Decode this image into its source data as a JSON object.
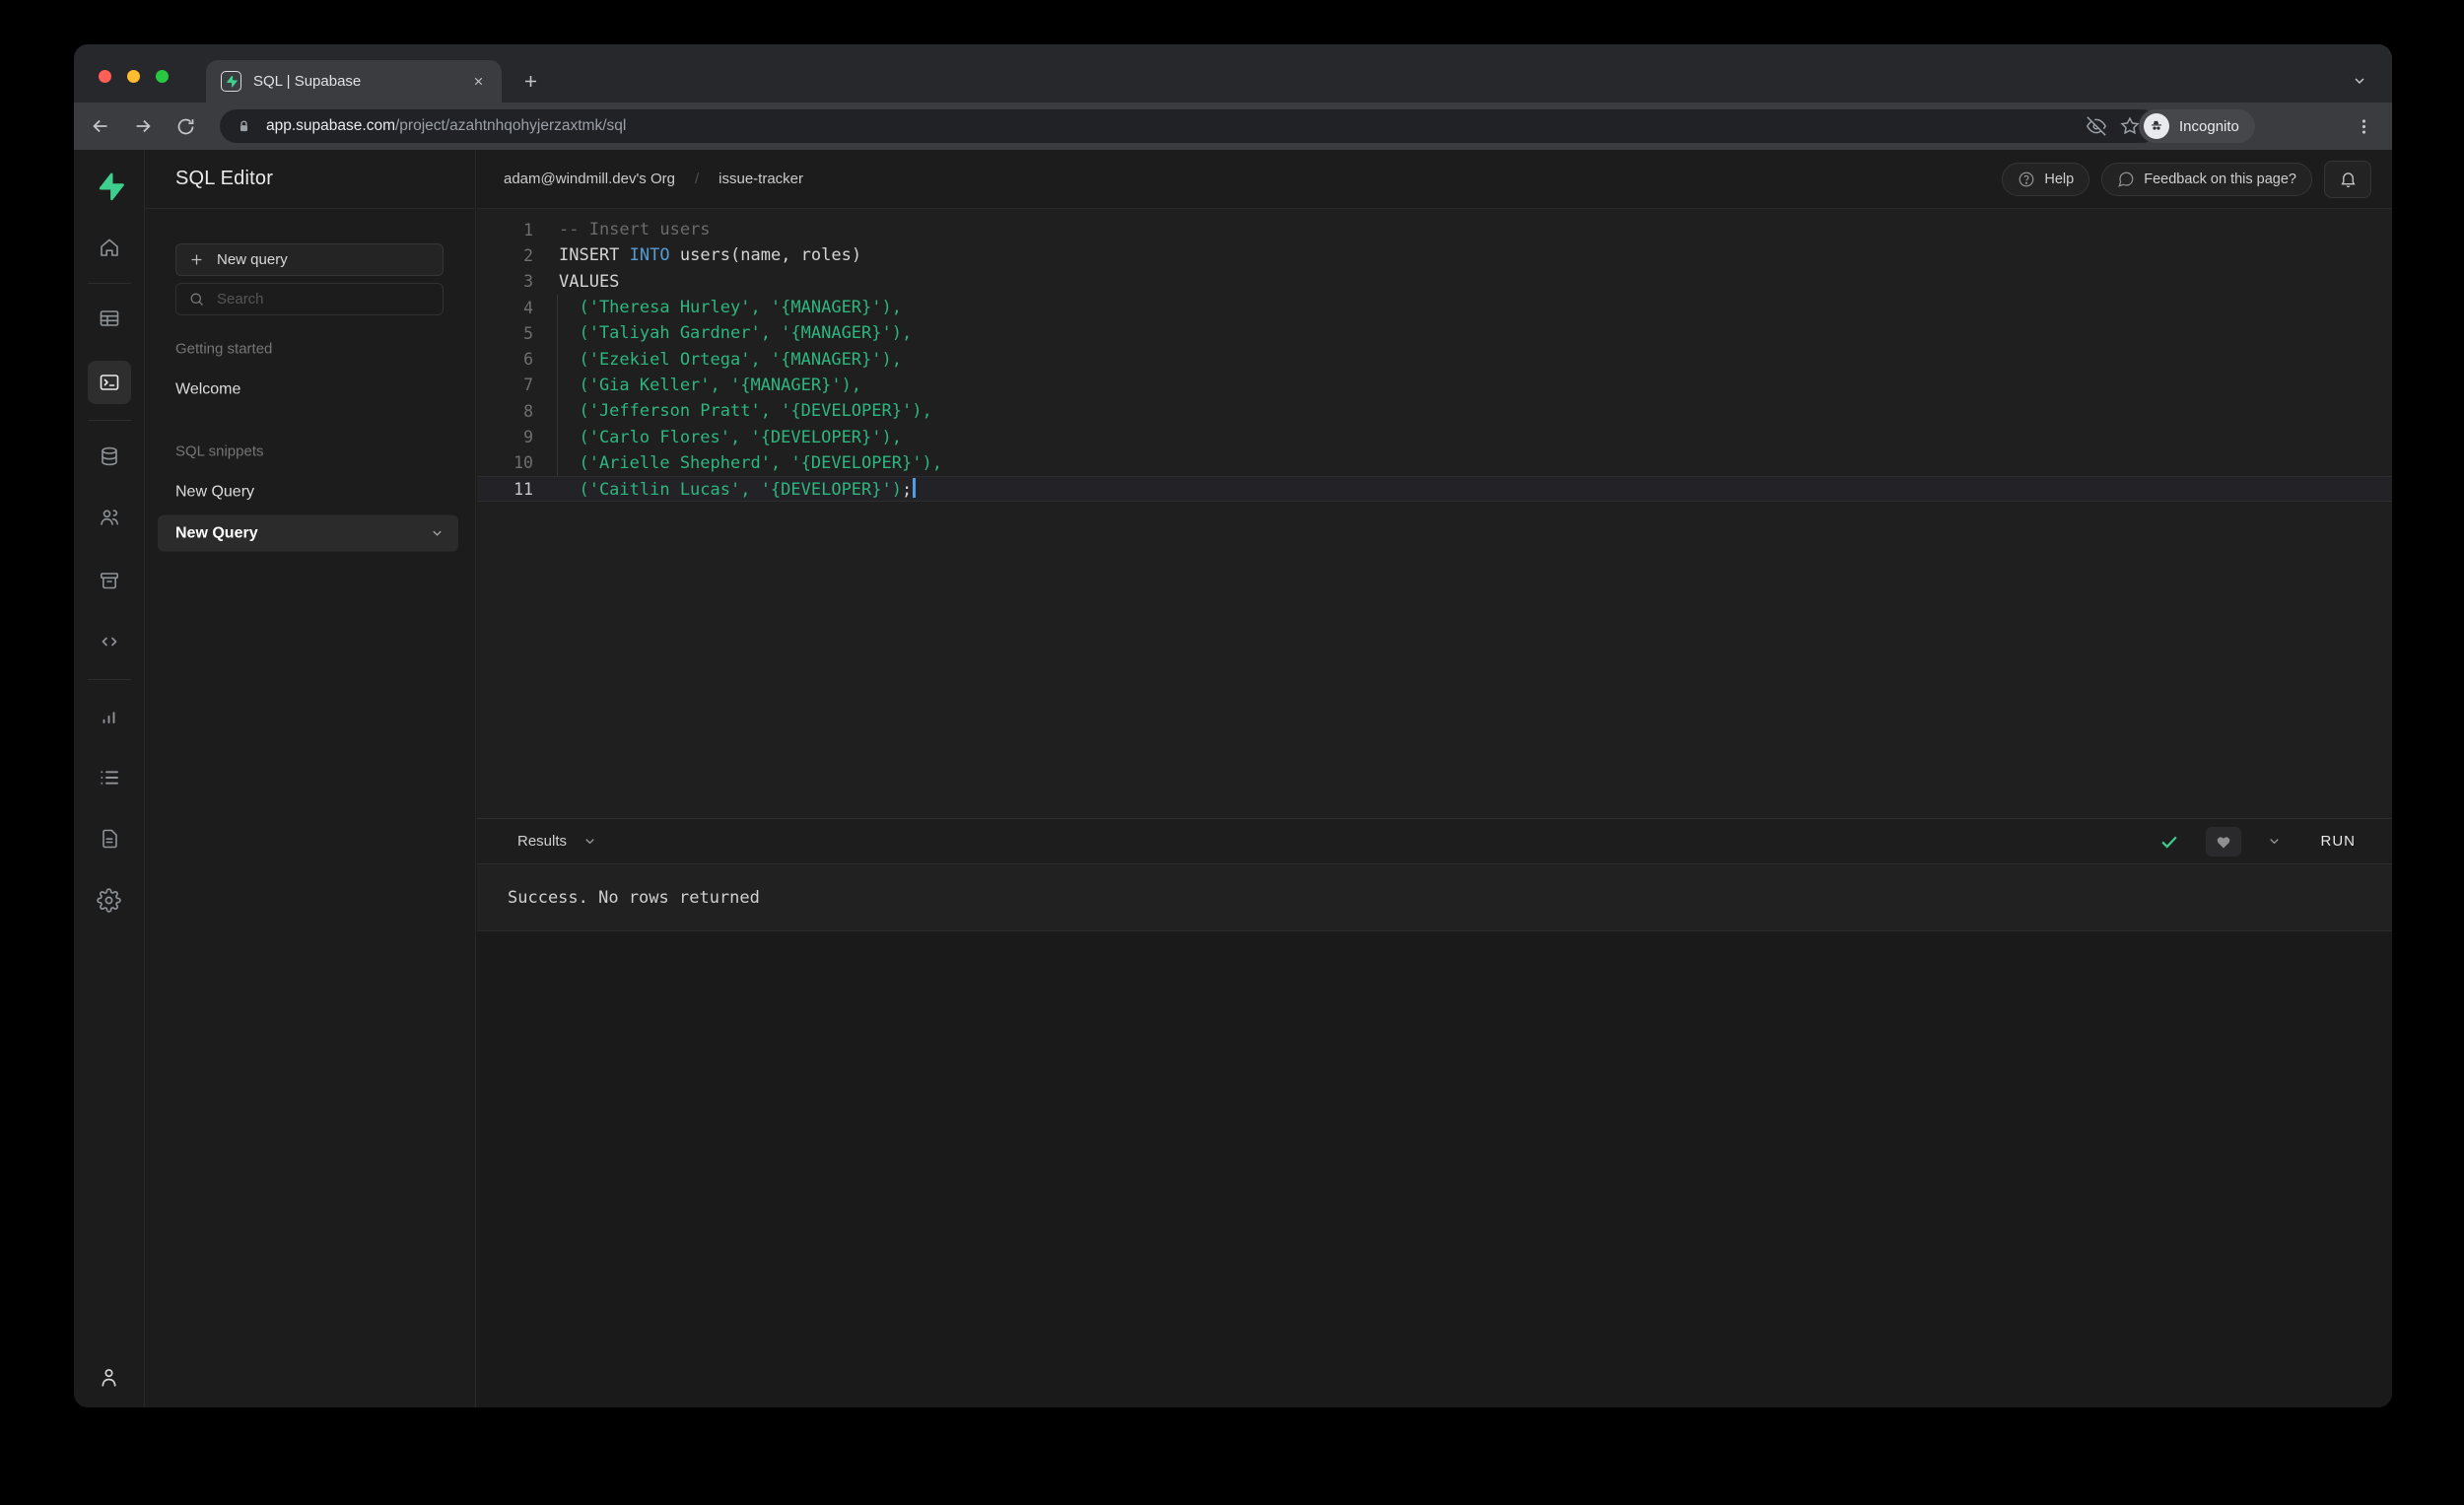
{
  "browser": {
    "tab": {
      "title": "SQL | Supabase"
    },
    "url": {
      "domain": "app.supabase.com",
      "path": "/project/azahtnhqohyjerzaxtmk/sql"
    },
    "incognito_label": "Incognito"
  },
  "rail": {
    "items": [
      {
        "name": "supabase-logo"
      },
      {
        "name": "home"
      },
      {
        "name": "divider"
      },
      {
        "name": "table-editor"
      },
      {
        "name": "sql-editor",
        "active": true
      },
      {
        "name": "divider"
      },
      {
        "name": "database"
      },
      {
        "name": "auth"
      },
      {
        "name": "storage"
      },
      {
        "name": "edge-functions"
      },
      {
        "name": "divider"
      },
      {
        "name": "reports"
      },
      {
        "name": "logs"
      },
      {
        "name": "api-docs"
      },
      {
        "name": "settings"
      }
    ],
    "profile": {
      "name": "account"
    }
  },
  "sidebar": {
    "title": "SQL Editor",
    "new_query_label": "New query",
    "search_placeholder": "Search",
    "sections": [
      {
        "label": "Getting started",
        "items": [
          {
            "label": "Welcome"
          }
        ]
      },
      {
        "label": "SQL snippets",
        "items": [
          {
            "label": "New Query"
          },
          {
            "label": "New Query",
            "selected": true
          }
        ]
      }
    ]
  },
  "main_header": {
    "breadcrumb": {
      "org": "adam@windmill.dev's Org",
      "separator": "/",
      "project": "issue-tracker"
    },
    "help_label": "Help",
    "feedback_label": "Feedback on this page?"
  },
  "editor": {
    "token_colors": {
      "comment": "#6a6a6a",
      "keyword": "#569cd6",
      "string": "#2eb67f",
      "plain": "#d4d4d4"
    },
    "lines": [
      {
        "num": "1",
        "segments": [
          {
            "text": "-- Insert users",
            "token": "comment"
          }
        ]
      },
      {
        "num": "2",
        "segments": [
          {
            "text": "INSERT ",
            "token": "plain"
          },
          {
            "text": "INTO",
            "token": "keyword"
          },
          {
            "text": " users(name, roles)",
            "token": "plain"
          }
        ]
      },
      {
        "num": "3",
        "segments": [
          {
            "text": "VALUES",
            "token": "plain"
          }
        ]
      },
      {
        "num": "4",
        "segments": [
          {
            "text": "  ('Theresa Hurley', '{MANAGER}'),",
            "token": "string"
          }
        ]
      },
      {
        "num": "5",
        "segments": [
          {
            "text": "  ('Taliyah Gardner', '{MANAGER}'),",
            "token": "string"
          }
        ]
      },
      {
        "num": "6",
        "segments": [
          {
            "text": "  ('Ezekiel Ortega', '{MANAGER}'),",
            "token": "string"
          }
        ]
      },
      {
        "num": "7",
        "segments": [
          {
            "text": "  ('Gia Keller', '{MANAGER}'),",
            "token": "string"
          }
        ]
      },
      {
        "num": "8",
        "segments": [
          {
            "text": "  ('Jefferson Pratt', '{DEVELOPER}'),",
            "token": "string"
          }
        ]
      },
      {
        "num": "9",
        "segments": [
          {
            "text": "  ('Carlo Flores', '{DEVELOPER}'),",
            "token": "string"
          }
        ]
      },
      {
        "num": "10",
        "segments": [
          {
            "text": "  ('Arielle Shepherd', '{DEVELOPER}'),",
            "token": "string"
          }
        ]
      },
      {
        "num": "11",
        "segments": [
          {
            "text": "  ('Caitlin Lucas', '{DEVELOPER}')",
            "token": "string"
          },
          {
            "text": ";",
            "token": "plain"
          }
        ],
        "active": true,
        "cursor": true
      }
    ]
  },
  "results": {
    "label": "Results",
    "run_label": "RUN",
    "message": "Success. No rows returned"
  },
  "colors": {
    "brand_green": "#3ecf8e",
    "success_check": "#3ecf8e",
    "cursor_blue": "#4e9de6",
    "string_green": "#2eb67f",
    "keyword_blue": "#569cd6"
  }
}
